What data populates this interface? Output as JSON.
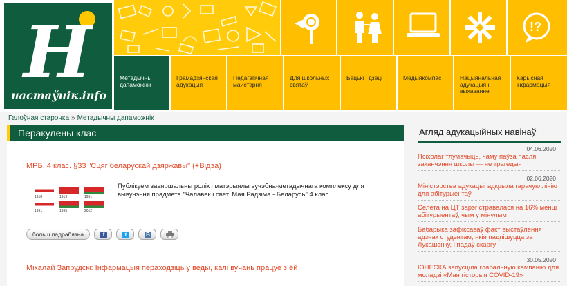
{
  "logo": {
    "letter": "Н",
    "site": "настаўнік.info"
  },
  "nav": [
    {
      "label": "Метадычны дапаможнік",
      "active": true
    },
    {
      "label": "Грамадзянская адукацыя",
      "active": false
    },
    {
      "label": "Педагагічная майстэрня",
      "active": false
    },
    {
      "label": "Для школьных святаў",
      "active": false
    },
    {
      "label": "Бацькі і дзеці",
      "active": false
    },
    {
      "label": "Медыякомпас",
      "active": false
    },
    {
      "label": "Нацыянальная адукацыя і выхаванне",
      "active": false
    },
    {
      "label": "Карысная інфармацыя",
      "active": false
    }
  ],
  "tiles": [
    "lollipop-icon",
    "family-icon",
    "laptop-icon",
    "ornament-star-icon",
    "question-bubble-icon"
  ],
  "breadcrumb": {
    "home": "Галоўная старонка",
    "sep": "»",
    "current": "Метадычны дапаможнік"
  },
  "section": {
    "title": "Перакулены клас"
  },
  "articles": [
    {
      "title": "МРБ. 4 клас. §33 \"Сцяг беларускай дзяржавы\" (+Відэа)",
      "text": "Публікуем завяршальны ролік і матэрыялы вучэбна-метадычнага комплексу для вывучэння прадмета \"Чалавек і свет. Мая Радзіма - Беларусь\" 4 клас."
    },
    {
      "title": "Мікалай Запрудскі: Інфармацыя пераходзіць у веды, калі вучань працуе з ёй"
    }
  ],
  "buttons": {
    "more": "больш падрабязна",
    "fb": "f",
    "tw": "t",
    "vk": "B",
    "print": "print-icon"
  },
  "thumb_labels": [
    "1918",
    "1919",
    "1951",
    "1991",
    "1995",
    "2012"
  ],
  "sidebar": {
    "title": "Агляд адукацыйных навінаў",
    "news": [
      {
        "date": "04.06.2020",
        "text": "Псіхолаг тлумачыць, чаму паўза пасля заканчэння школы — не трагедыя"
      },
      {
        "date": "02.06.2020",
        "text": "Міністэрства адукацыі адкрыла гарачую лінію для абітурыентаў"
      },
      {
        "date": "",
        "text": "Селета на ЦТ зарэгістравалася на 16% менш абітурыентаў, чым у мінулым"
      },
      {
        "date": "",
        "text": "Бабарыка зафіксаваў факт выстаўлення адзнак студэнтам, якія падпішуцца за Лукашэнку, і падаў скаргу"
      },
      {
        "date": "30.05.2020",
        "text": "ЮНЕСКА запусціла глабальную кампанію для моладзі «Мая гісторыя COVID-19»"
      }
    ]
  },
  "colors": {
    "green": "#0f5c3f",
    "yellow": "#ffbf00",
    "accent": "#e24a2b"
  }
}
